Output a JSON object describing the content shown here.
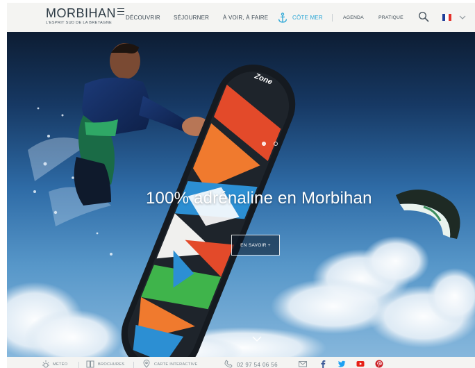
{
  "header": {
    "logo_main": "MORBIHAN",
    "logo_tagline": "L'ESPRIT SUD DE LA BRETAGNE",
    "nav": [
      {
        "label": "DÉCOUVRIR"
      },
      {
        "label": "SÉJOURNER"
      },
      {
        "label": "À VOIR, À FAIRE"
      },
      {
        "label": "CÔTE MER"
      },
      {
        "label": "AGENDA"
      },
      {
        "label": "PRATIQUE"
      }
    ],
    "icons": {
      "anchor": "anchor-icon",
      "search": "search-icon",
      "language": "flag-fr-icon",
      "dropdown": "chevron-down-icon"
    },
    "accent_color": "#2aa6d6",
    "flag_colors": [
      "#1f3f9a",
      "#ffffff",
      "#e4322b"
    ]
  },
  "hero": {
    "title": "100% adrénaline en Morbihan",
    "cta_label": "EN SAVOIR +",
    "board_brand": "Zone",
    "slides_total": 2,
    "active_slide": 1
  },
  "footer": {
    "items": [
      {
        "label": "MÉTÉO",
        "icon": "sun-icon"
      },
      {
        "label": "BROCHURES",
        "icon": "brochure-icon"
      },
      {
        "label": "CARTE INTERACTIVE",
        "icon": "map-pin-icon"
      }
    ],
    "phone": "02 97 54 06 56",
    "contact_icons": [
      "phone-icon",
      "mail-icon"
    ],
    "social": [
      {
        "name": "facebook-icon",
        "color": "#3b5998"
      },
      {
        "name": "twitter-icon",
        "color": "#1da1f2"
      },
      {
        "name": "youtube-icon",
        "color": "#e62117"
      },
      {
        "name": "pinterest-icon",
        "color": "#cb2027"
      }
    ]
  }
}
